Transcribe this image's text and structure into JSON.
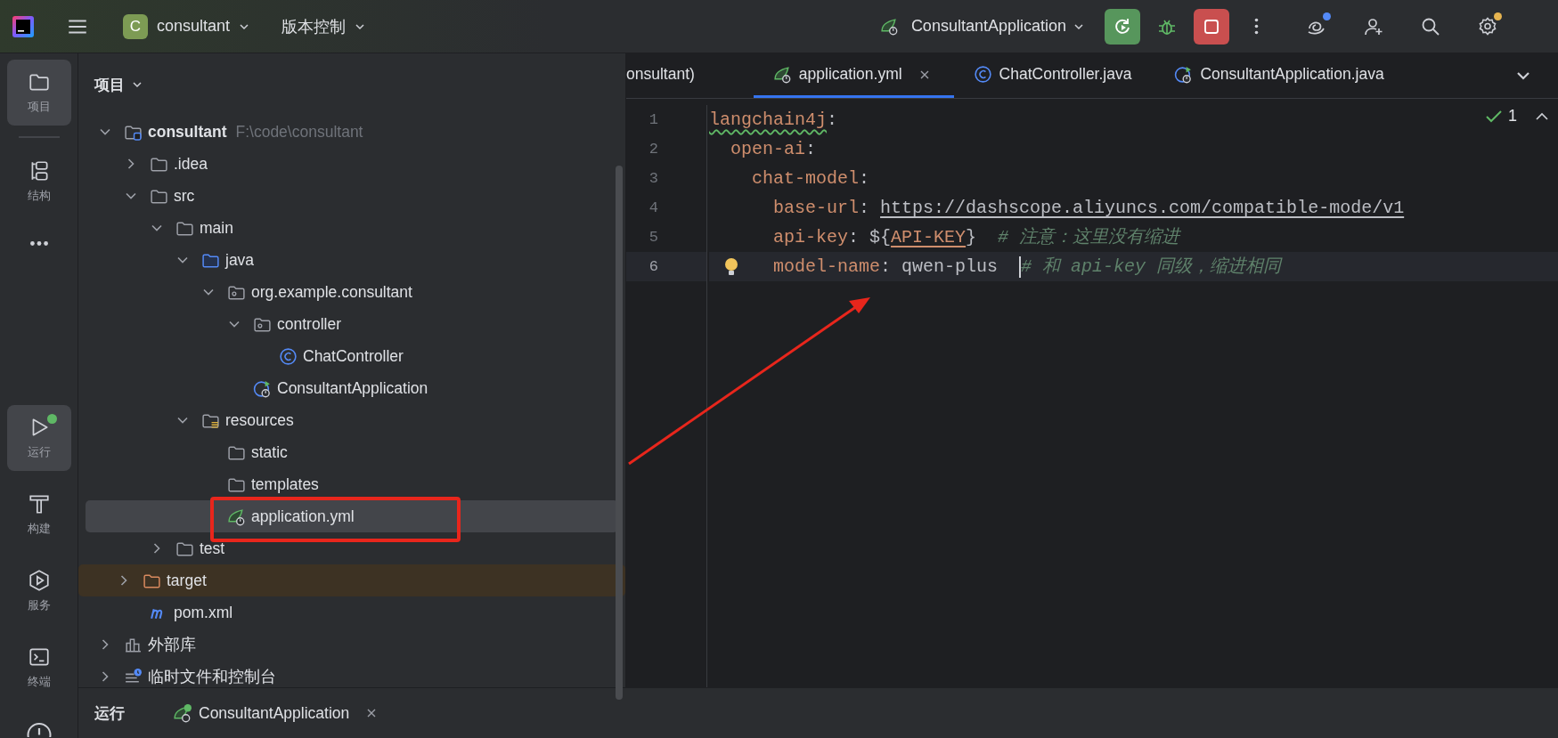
{
  "toolbar": {
    "project_badge": "C",
    "project": "consultant",
    "vcs": "版本控制",
    "run_config": "ConsultantApplication",
    "actions": [
      {
        "kind": "rerun",
        "notified": false
      },
      {
        "kind": "debug",
        "notified": false
      },
      {
        "kind": "stop",
        "notified": false
      },
      {
        "kind": "more",
        "notified": false
      },
      {
        "kind": "ai",
        "notified": true
      },
      {
        "kind": "add-user",
        "notified": false
      },
      {
        "kind": "search",
        "notified": false
      },
      {
        "kind": "settings",
        "notified": true
      }
    ]
  },
  "tool_strip": {
    "top": [
      {
        "kind": "project",
        "label": "项目",
        "selected": true,
        "running": false
      },
      {
        "kind": "structure",
        "label": "结构",
        "selected": false,
        "running": false
      },
      {
        "kind": "more",
        "selected": false,
        "running": false
      }
    ],
    "bottom": [
      {
        "kind": "run",
        "label": "运行",
        "selected": true,
        "running": true
      },
      {
        "kind": "build",
        "label": "构建",
        "selected": false,
        "running": false
      },
      {
        "kind": "services",
        "label": "服务",
        "selected": false,
        "running": false
      },
      {
        "kind": "terminal",
        "label": "终端",
        "selected": false,
        "running": false
      },
      {
        "kind": "problems",
        "selected": false,
        "running": false
      }
    ]
  },
  "project_panel": {
    "title": "项目",
    "tree": [
      {
        "name": "consultant",
        "path": "F:\\code\\consultant",
        "kind": "module",
        "expanded": true,
        "selected": false,
        "excluded": false,
        "children": [
          {
            "name": ".idea",
            "kind": "folder",
            "expanded": false,
            "selected": false,
            "excluded": false
          },
          {
            "name": "src",
            "kind": "folder",
            "expanded": true,
            "selected": false,
            "excluded": false,
            "children": [
              {
                "name": "main",
                "kind": "folder",
                "expanded": true,
                "selected": false,
                "excluded": false,
                "children": [
                  {
                    "name": "java",
                    "kind": "source",
                    "expanded": true,
                    "selected": false,
                    "excluded": false,
                    "children": [
                      {
                        "name": "org.example.consultant",
                        "kind": "package",
                        "expanded": true,
                        "selected": false,
                        "excluded": false,
                        "children": [
                          {
                            "name": "controller",
                            "kind": "package",
                            "expanded": true,
                            "selected": false,
                            "excluded": false,
                            "children": [
                              {
                                "name": "ChatController",
                                "kind": "class",
                                "selected": false,
                                "excluded": false
                              }
                            ]
                          },
                          {
                            "name": "ConsultantApplication",
                            "kind": "spring-class",
                            "selected": false,
                            "excluded": false
                          }
                        ]
                      }
                    ]
                  },
                  {
                    "name": "resources",
                    "kind": "resources",
                    "expanded": true,
                    "selected": false,
                    "excluded": false,
                    "children": [
                      {
                        "name": "static",
                        "kind": "folder",
                        "selected": false,
                        "excluded": false
                      },
                      {
                        "name": "templates",
                        "kind": "folder",
                        "selected": false,
                        "excluded": false
                      },
                      {
                        "name": "application.yml",
                        "kind": "yml",
                        "selected": true,
                        "excluded": false
                      }
                    ]
                  }
                ]
              },
              {
                "name": "test",
                "kind": "folder",
                "expanded": false,
                "selected": false,
                "excluded": false
              }
            ]
          },
          {
            "name": "target",
            "kind": "folder",
            "expanded": false,
            "selected": false,
            "excluded": true
          },
          {
            "name": "pom.xml",
            "kind": "maven",
            "selected": false,
            "excluded": false
          }
        ]
      },
      {
        "name": "外部库",
        "kind": "library",
        "expanded": false,
        "selected": false,
        "excluded": false
      },
      {
        "name": "临时文件和控制台",
        "kind": "scratch",
        "expanded": false,
        "selected": false,
        "excluded": false
      }
    ]
  },
  "editor": {
    "tabs": [
      {
        "label": "onsultant)",
        "kind": "none",
        "selected": false,
        "closable": false
      },
      {
        "label": "application.yml",
        "kind": "yml",
        "selected": true,
        "closable": true
      },
      {
        "label": "ChatController.java",
        "kind": "class",
        "selected": false,
        "closable": false
      },
      {
        "label": "ConsultantApplication.java",
        "kind": "spring-class",
        "selected": false,
        "closable": false
      }
    ],
    "inspection_count": "1",
    "lines": [
      {
        "number": "1",
        "current": false,
        "bulb": false,
        "tokens": [
          {
            "kind": "key-warn",
            "text": "langchain4j"
          },
          {
            "kind": "punct",
            "text": ":"
          }
        ]
      },
      {
        "number": "2",
        "current": false,
        "bulb": false,
        "tokens": [
          {
            "kind": "key",
            "text": "  open-ai"
          },
          {
            "kind": "punct",
            "text": ":"
          }
        ]
      },
      {
        "number": "3",
        "current": false,
        "bulb": false,
        "tokens": [
          {
            "kind": "key",
            "text": "    chat-model"
          },
          {
            "kind": "punct",
            "text": ":"
          }
        ]
      },
      {
        "number": "4",
        "current": false,
        "bulb": false,
        "tokens": [
          {
            "kind": "key",
            "text": "      base-url"
          },
          {
            "kind": "punct",
            "text": ": "
          },
          {
            "kind": "url",
            "text": "https://dashscope.aliyuncs.com/compatible-mode/v1"
          }
        ]
      },
      {
        "number": "5",
        "current": false,
        "bulb": false,
        "tokens": [
          {
            "kind": "key",
            "text": "      api-key"
          },
          {
            "kind": "punct",
            "text": ": ${"
          },
          {
            "kind": "var",
            "text": "API-KEY"
          },
          {
            "kind": "punct",
            "text": "}  "
          },
          {
            "kind": "comment",
            "text": "# 注意：这里没有缩进"
          }
        ]
      },
      {
        "number": "6",
        "current": true,
        "bulb": true,
        "tokens": [
          {
            "kind": "key",
            "text": "      model-name"
          },
          {
            "kind": "punct",
            "text": ": qwen-plus  "
          },
          {
            "kind": "caret"
          },
          {
            "kind": "comment",
            "text": "# 和 api-key 同级，缩进相同"
          }
        ]
      }
    ]
  },
  "run_bar": {
    "title": "运行",
    "tabs": [
      {
        "label": "ConsultantApplication",
        "running": true,
        "closable": true
      }
    ]
  }
}
